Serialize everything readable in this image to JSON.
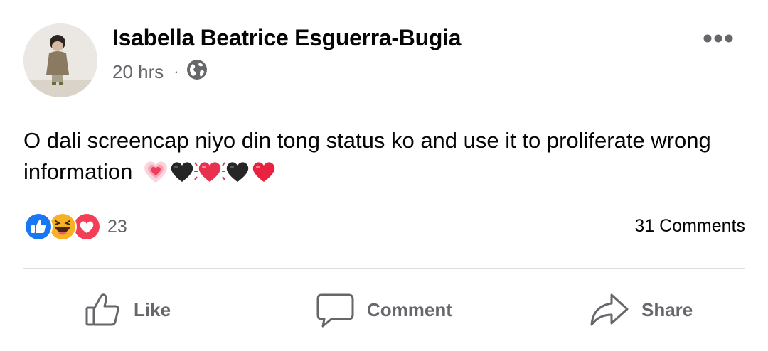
{
  "post": {
    "author": "Isabella Beatrice Esguerra-Bugia",
    "time": "20 hrs",
    "separator": "·",
    "privacy_icon": "globe-icon",
    "text": "O dali screencap niyo din tong status ko and use it to proliferate wrong information",
    "emojis": [
      "pink-glowing-heart",
      "black-heart",
      "beating-heart",
      "black-heart",
      "red-heart"
    ]
  },
  "reactions": {
    "icons": [
      "like-icon",
      "haha-icon",
      "love-icon"
    ],
    "count": "23"
  },
  "comments": {
    "count_label": "31 Comments"
  },
  "actions": {
    "like_label": "Like",
    "comment_label": "Comment",
    "share_label": "Share"
  },
  "colors": {
    "like_blue": "#1877f2",
    "love_red": "#f33e58",
    "haha_yellow": "#f7b125",
    "secondary_text": "#65676b"
  }
}
